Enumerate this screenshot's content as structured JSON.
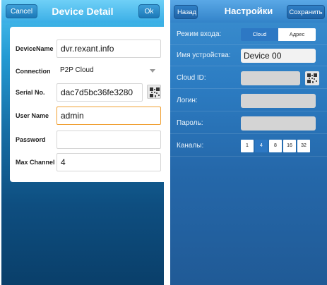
{
  "left": {
    "title": "Device Detail",
    "cancel_label": "Cancel",
    "ok_label": "Ok",
    "rows": {
      "device_name": {
        "label": "DeviceName",
        "value": "dvr.rexant.info"
      },
      "connection": {
        "label": "Connection",
        "value": "P2P Cloud"
      },
      "serial": {
        "label": "Serial No.",
        "value": "dac7d5bc36fe3280"
      },
      "user": {
        "label": "User Name",
        "value": "admin"
      },
      "password": {
        "label": "Password",
        "value": ""
      },
      "max_channel": {
        "label": "Max Channel",
        "value": "4"
      }
    },
    "icons": {
      "qr": "qr-code-icon",
      "dropdown": "chevron-down-icon"
    }
  },
  "right": {
    "title": "Настройки",
    "back_label": "Назад",
    "save_label": "Сохранить",
    "mode": {
      "label": "Режим входа:",
      "options": [
        "Cloud",
        "Адрес"
      ],
      "selected": "Cloud"
    },
    "device_name": {
      "label": "Имя устройства:",
      "value": "Device 00"
    },
    "cloud_id": {
      "label": "Cloud ID:",
      "value": ""
    },
    "login": {
      "label": "Логин:",
      "value": ""
    },
    "password": {
      "label": "Пароль:",
      "value": ""
    },
    "channels": {
      "label": "Каналы:",
      "options": [
        "1",
        "4",
        "8",
        "16",
        "32"
      ],
      "selected": "4"
    }
  },
  "colors": {
    "accent_orange": "#f0a033",
    "left_header": "#3aaee6",
    "right_header": "#3283c9",
    "segment_selected": "#2d78c4"
  }
}
